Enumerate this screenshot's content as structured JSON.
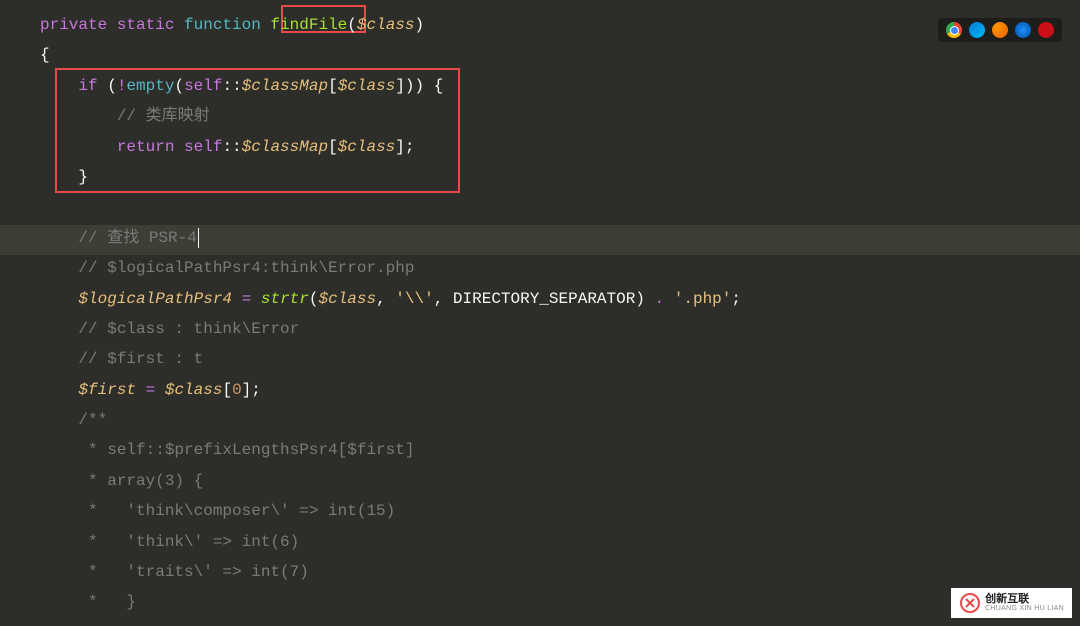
{
  "code": {
    "l1_private": "private",
    "l1_static": "static",
    "l1_function": "function",
    "l1_fnname": "findFile",
    "l1_var": "$class",
    "l2_brace": "{",
    "l3_if": "if",
    "l3_empty": "empty",
    "l3_self": "self",
    "l3_classMap": "$classMap",
    "l3_class": "$class",
    "l4_comment": "// 类库映射",
    "l5_return": "return",
    "l5_self": "self",
    "l5_classMap": "$classMap",
    "l5_class": "$class",
    "l6_brace": "}",
    "l8_comment": "// 查找 PSR-4",
    "l9_comment": "// $logicalPathPsr4:think\\Error.php",
    "l10_var": "$logicalPathPsr4",
    "l10_strtr": "strtr",
    "l10_class": "$class",
    "l10_str1": "'\\\\'",
    "l10_const": "DIRECTORY_SEPARATOR",
    "l10_str2": "'.php'",
    "l11_comment": "// $class : think\\Error",
    "l12_comment": "// $first : t",
    "l13_first": "$first",
    "l13_class": "$class",
    "l13_idx": "0",
    "l14_comment": "/**",
    "l15_comment": " * self::$prefixLengthsPsr4[$first]",
    "l16_comment": " * array(3) {",
    "l17_comment": " *   'think\\composer\\' => int(15)",
    "l18_comment": " *   'think\\' => int(6)",
    "l19_comment": " *   'traits\\' => int(7)",
    "l20_comment": " *   }"
  },
  "icons": {
    "chrome": "chrome-icon",
    "edge": "edge-icon",
    "firefox": "firefox-icon",
    "safari": "safari-icon",
    "opera": "opera-icon"
  },
  "watermark": {
    "cn": "创新互联",
    "en": "CHUANG XIN HU LIAN"
  }
}
